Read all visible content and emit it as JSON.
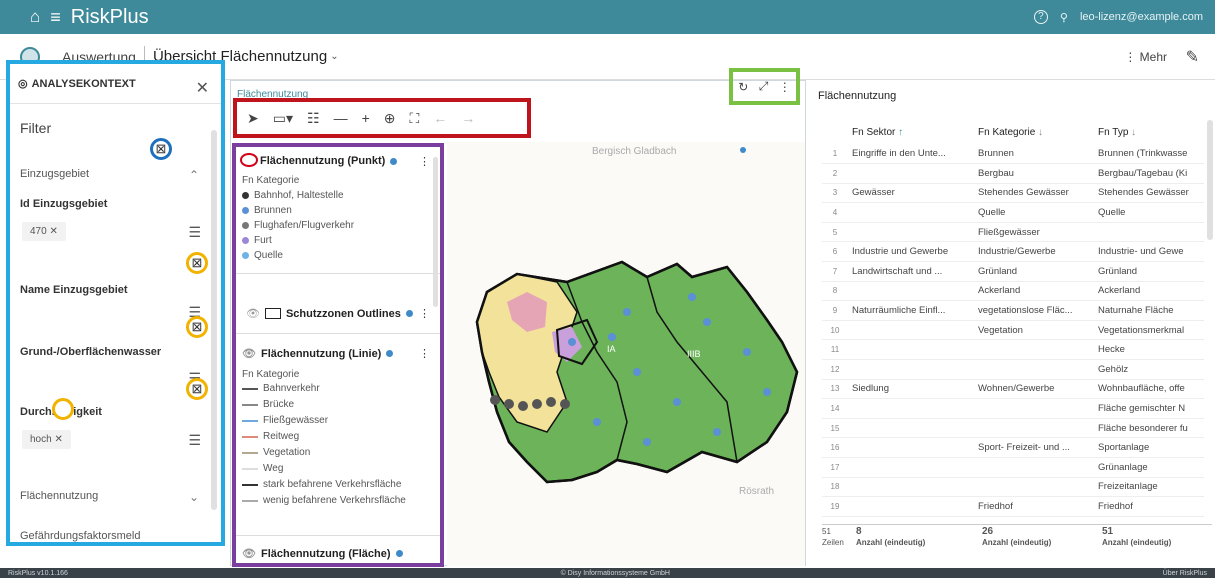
{
  "app": {
    "title": "RiskPlus",
    "user": "leo-lizenz@example.com",
    "version": "RiskPlus v10.1.166",
    "copyright": "© Disy Informationssysteme GmbH",
    "about": "Über RiskPlus"
  },
  "subbar": {
    "crumb1": "Auswertung",
    "crumb2": "Übersicht Flächennutzung",
    "more": "Mehr"
  },
  "left": {
    "head": "ANALYSEKONTEXT",
    "filter": "Filter",
    "groups": [
      {
        "label": "Einzugsgebiet"
      },
      {
        "label": "Id Einzugsgebiet",
        "value": "470"
      },
      {
        "label": "Name Einzugsgebiet"
      },
      {
        "label": "Grund-/Oberflächenwasser"
      },
      {
        "label": "Durchlässigkeit",
        "value": "hoch"
      },
      {
        "label": "Flächennutzung"
      },
      {
        "label": "Gefährdungsfaktorsmeld"
      }
    ]
  },
  "map": {
    "title": "Flächennutzung",
    "place1": "Bergisch Gladbach",
    "place2": "Rösrath",
    "lab1": "IA",
    "lab2": "IIIB"
  },
  "legend": {
    "layer1": "Flächennutzung (Punkt)",
    "cat": "Fn Kategorie",
    "points": [
      "Bahnhof, Haltestelle",
      "Brunnen",
      "Flughafen/Flugverkehr",
      "Furt",
      "Quelle"
    ],
    "layer2": "Schutzzonen Outlines",
    "layer3": "Flächennutzung (Linie)",
    "lines": [
      "Bahnverkehr",
      "Brücke",
      "Fließgewässer",
      "Reitweg",
      "Vegetation",
      "Weg",
      "stark befahrene Verkehrsfläche",
      "wenig befahrene Verkehrsfläche"
    ],
    "layer4": "Flächennutzung (Fläche)"
  },
  "table": {
    "title": "Flächennutzung",
    "cols": [
      "Fn Sektor",
      "Fn Kategorie",
      "Fn Typ"
    ],
    "rows": [
      [
        "1",
        "Eingriffe in den Unte...",
        "Brunnen",
        "Brunnen (Trinkwasse"
      ],
      [
        "2",
        "",
        "Bergbau",
        "Bergbau/Tagebau (Ki"
      ],
      [
        "3",
        "Gewässer",
        "Stehendes Gewässer",
        "Stehendes Gewässer"
      ],
      [
        "4",
        "",
        "Quelle",
        "Quelle"
      ],
      [
        "5",
        "",
        "Fließgewässer",
        ""
      ],
      [
        "6",
        "Industrie und Gewerbe",
        "Industrie/Gewerbe",
        "Industrie- und Gewe"
      ],
      [
        "7",
        "Landwirtschaft und ...",
        "Grünland",
        "Grünland"
      ],
      [
        "8",
        "",
        "Ackerland",
        "Ackerland"
      ],
      [
        "9",
        "Naturräumliche Einfl...",
        "vegetationslose Fläc...",
        "Naturnahe Fläche"
      ],
      [
        "10",
        "",
        "Vegetation",
        "Vegetationsmerkmal"
      ],
      [
        "11",
        "",
        "",
        "Hecke"
      ],
      [
        "12",
        "",
        "",
        "Gehölz"
      ],
      [
        "13",
        "Siedlung",
        "Wohnen/Gewerbe",
        "Wohnbaufläche, offe"
      ],
      [
        "14",
        "",
        "",
        "Fläche gemischter N"
      ],
      [
        "15",
        "",
        "",
        "Fläche besonderer fu"
      ],
      [
        "16",
        "",
        "Sport- Freizeit- und ...",
        "Sportanlage"
      ],
      [
        "17",
        "",
        "",
        "Grünanlage"
      ],
      [
        "18",
        "",
        "",
        "Freizeitanlage"
      ],
      [
        "19",
        "",
        "Friedhof",
        "Friedhof"
      ]
    ],
    "footer": {
      "rows": "51",
      "rowsLabel": "Zeilen",
      "c1": "8",
      "c2": "26",
      "c3": "51",
      "agg": "Anzahl (eindeutig)"
    }
  }
}
